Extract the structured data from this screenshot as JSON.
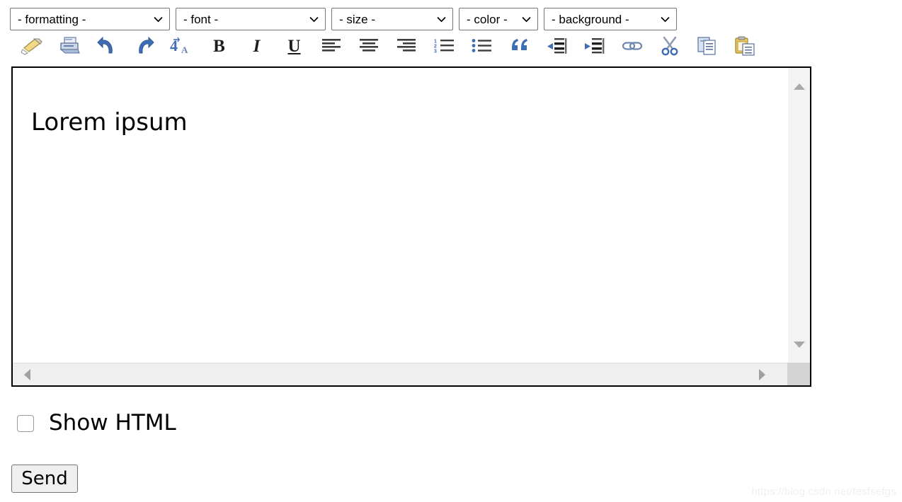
{
  "selects": [
    {
      "name": "formatting",
      "value": "- formatting -",
      "icon": "chevron-down-icon"
    },
    {
      "name": "font",
      "value": "- font -",
      "icon": "chevron-down-icon"
    },
    {
      "name": "size",
      "value": "- size -",
      "icon": "chevron-down-icon"
    },
    {
      "name": "color",
      "value": "- color -",
      "icon": "chevron-down-icon"
    },
    {
      "name": "background",
      "value": "- background -",
      "icon": "chevron-down-icon"
    }
  ],
  "toolbar": {
    "buttons": [
      {
        "name": "clean-formatting-brush-icon",
        "label": "Clean formatting"
      },
      {
        "name": "print-icon",
        "label": "Print"
      },
      {
        "name": "undo-icon",
        "label": "Undo"
      },
      {
        "name": "redo-icon",
        "label": "Redo"
      },
      {
        "name": "change-case-icon",
        "label": "Change case"
      },
      {
        "name": "bold-icon",
        "label": "B"
      },
      {
        "name": "italic-icon",
        "label": "I"
      },
      {
        "name": "underline-icon",
        "label": "U"
      },
      {
        "name": "align-left-icon",
        "label": "Align left"
      },
      {
        "name": "align-center-icon",
        "label": "Align center"
      },
      {
        "name": "align-right-icon",
        "label": "Align right"
      },
      {
        "name": "numbered-list-icon",
        "label": "Numbered list"
      },
      {
        "name": "bullet-list-icon",
        "label": "Bullet list"
      },
      {
        "name": "blockquote-icon",
        "label": "Blockquote"
      },
      {
        "name": "outdent-icon",
        "label": "Outdent"
      },
      {
        "name": "indent-icon",
        "label": "Indent"
      },
      {
        "name": "link-icon",
        "label": "Insert link"
      },
      {
        "name": "cut-scissors-icon",
        "label": "Cut"
      },
      {
        "name": "copy-icon",
        "label": "Copy"
      },
      {
        "name": "paste-clipboard-icon",
        "label": "Paste"
      }
    ]
  },
  "editor": {
    "content": "Lorem ipsum",
    "vertical_scrollbar": {
      "up_icon": "scroll-up-arrow-icon",
      "down_icon": "scroll-down-arrow-icon"
    },
    "horizontal_scrollbar": {
      "left_icon": "scroll-left-arrow-icon",
      "right_icon": "scroll-right-arrow-icon"
    }
  },
  "show_html": {
    "label": "Show HTML",
    "checked": false
  },
  "send": {
    "label": "Send"
  },
  "watermark": {
    "text": "https://blog.csdn.net/fesfsefgs"
  },
  "colors": {
    "page_background": "#ffffff",
    "editor_border": "#000000",
    "scrollbar_track": "#f3f3f3",
    "scrollbar_arrow": "#9e9e9e",
    "button_face": "#efefef",
    "select_border": "#767676",
    "icon_blue": "#4a6ea9",
    "icon_dark": "#3a3a3a",
    "watermark": "#f0f0f0"
  }
}
